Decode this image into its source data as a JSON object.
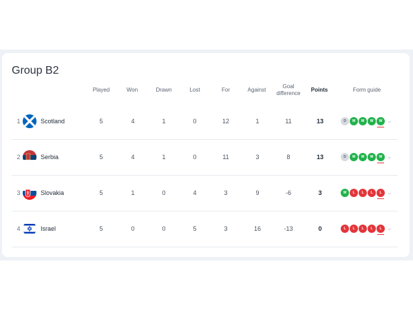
{
  "group_title": "Group B2",
  "headers": {
    "played": "Played",
    "won": "Won",
    "drawn": "Drawn",
    "lost": "Lost",
    "for": "For",
    "against": "Against",
    "goal_difference_line1": "Goal",
    "goal_difference_line2": "difference",
    "points": "Points",
    "form_guide": "Form guide"
  },
  "rows": [
    {
      "rank": "1",
      "team": "Scotland",
      "played": "5",
      "won": "4",
      "drawn": "1",
      "lost": "0",
      "for": "12",
      "against": "1",
      "gd": "11",
      "points": "13",
      "form": [
        "D",
        "W",
        "W",
        "W",
        "W"
      ],
      "flag": "scotland"
    },
    {
      "rank": "2",
      "team": "Serbia",
      "played": "5",
      "won": "4",
      "drawn": "1",
      "lost": "0",
      "for": "11",
      "against": "3",
      "gd": "8",
      "points": "13",
      "form": [
        "D",
        "W",
        "W",
        "W",
        "W"
      ],
      "flag": "serbia"
    },
    {
      "rank": "3",
      "team": "Slovakia",
      "played": "5",
      "won": "1",
      "drawn": "0",
      "lost": "4",
      "for": "3",
      "against": "9",
      "gd": "-6",
      "points": "3",
      "form": [
        "W",
        "L",
        "L",
        "L",
        "L"
      ],
      "flag": "slovakia"
    },
    {
      "rank": "4",
      "team": "Israel",
      "played": "5",
      "won": "0",
      "drawn": "0",
      "lost": "5",
      "for": "3",
      "against": "16",
      "gd": "-13",
      "points": "0",
      "form": [
        "L",
        "L",
        "L",
        "L",
        "L"
      ],
      "flag": "israel"
    }
  ],
  "colors": {
    "win": "#22b24c",
    "loss": "#e3353a",
    "draw": "#d7dae0"
  },
  "icons": {
    "expand": "chevron-down-icon"
  }
}
